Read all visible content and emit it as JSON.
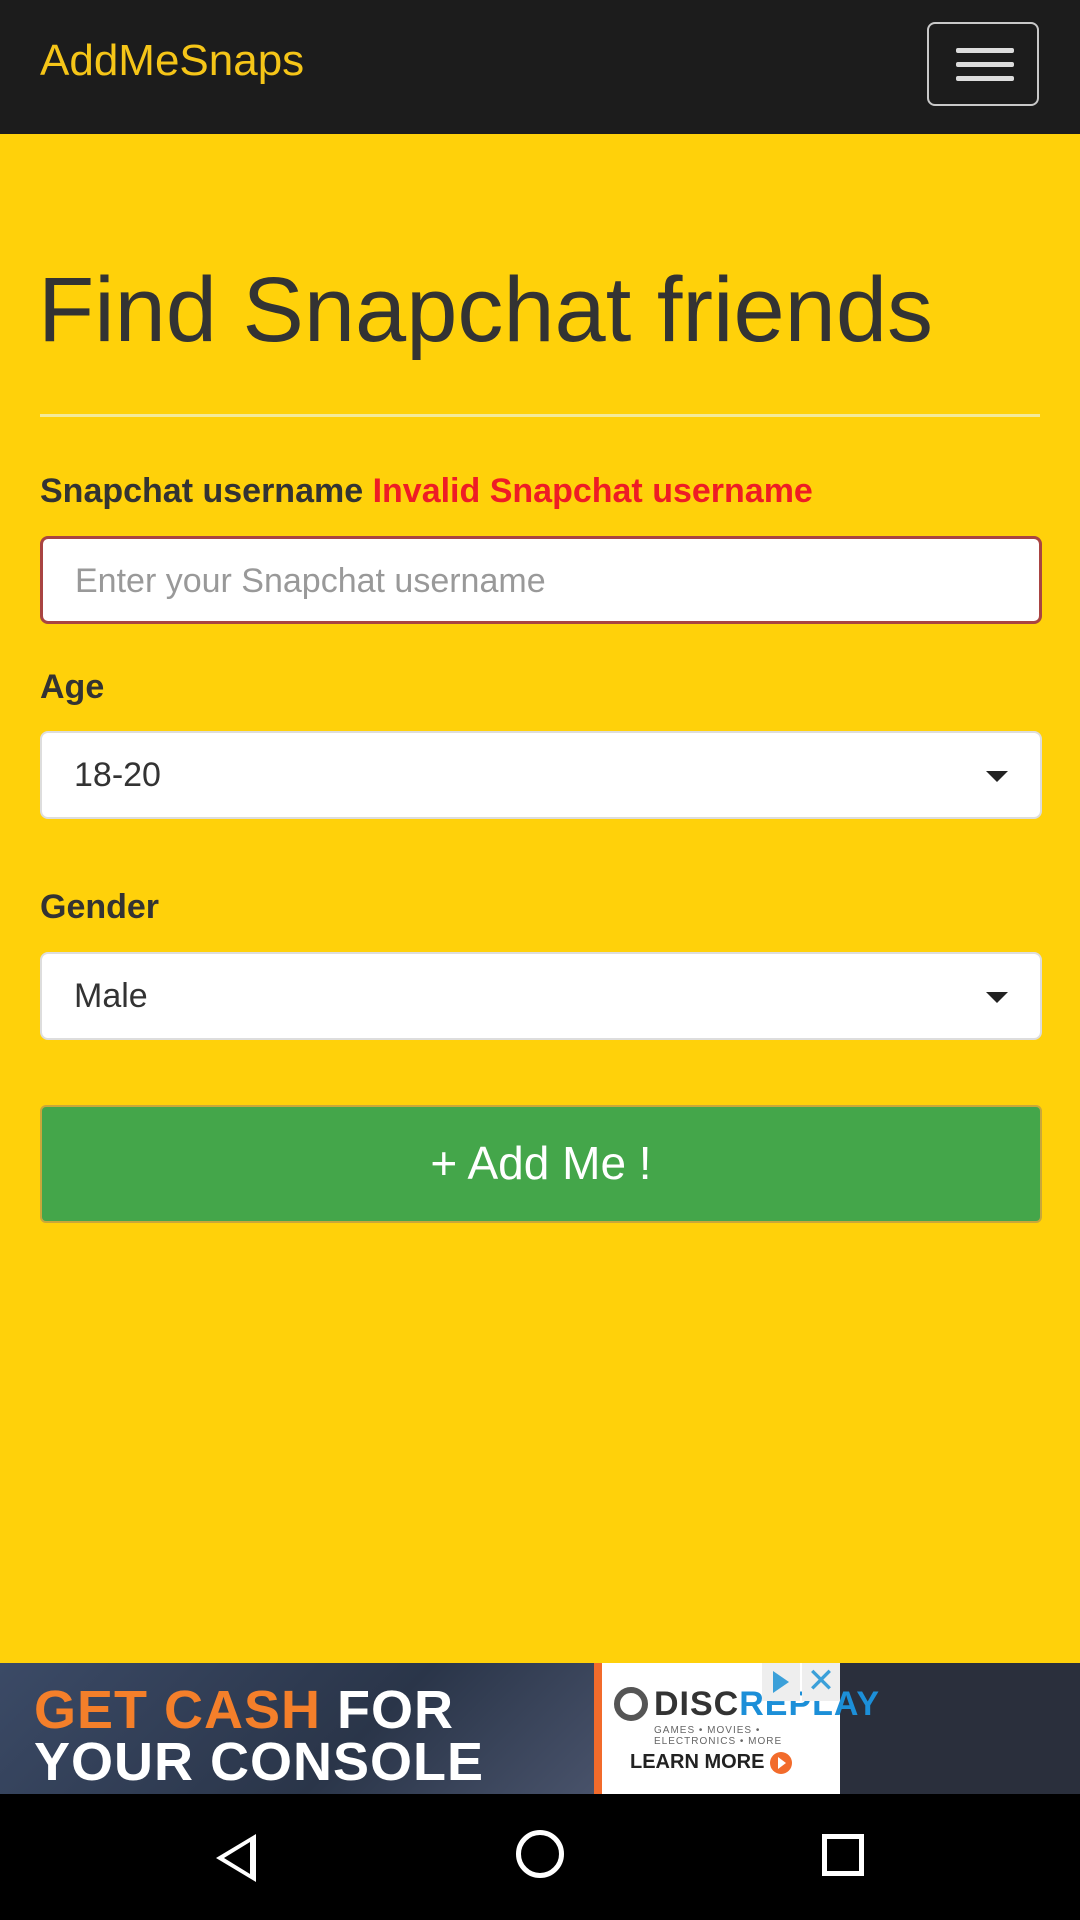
{
  "app": {
    "brand": "AddMeSnaps"
  },
  "page": {
    "title": "Find Snapchat friends"
  },
  "form": {
    "username_label": "Snapchat username",
    "username_error": "Invalid Snapchat username",
    "username_placeholder": "Enter your Snapchat username",
    "username_value": "",
    "age_label": "Age",
    "age_value": "18-20",
    "gender_label": "Gender",
    "gender_value": "Male",
    "submit_label": "+ Add Me !"
  },
  "ad": {
    "line1_a": "GET CASH",
    "line1_b": " FOR",
    "line2": "YOUR CONSOLE",
    "brand_a": "DISC",
    "brand_b": "REPLAY",
    "tagline": "GAMES • MOVIES • ELECTRONICS • MORE",
    "cta": "LEARN MORE",
    "close": "✕"
  },
  "colors": {
    "background": "#ffd10a",
    "topbar": "#1c1c1c",
    "brand": "#f5c518",
    "error": "#ee1c25",
    "button": "#44a64a"
  },
  "icons": {
    "menu": "hamburger-icon",
    "caret": "chevron-down-icon",
    "back": "back-icon",
    "home": "home-icon",
    "recents": "recents-icon"
  }
}
